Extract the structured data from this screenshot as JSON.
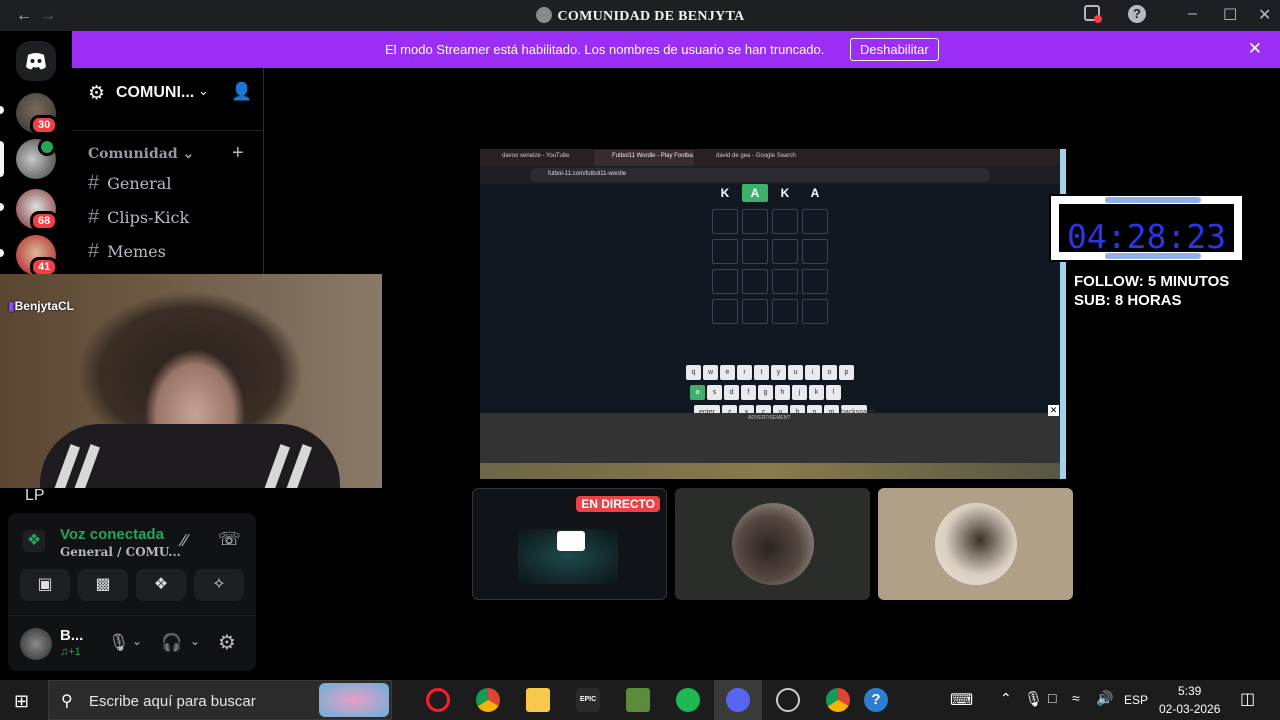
{
  "window": {
    "title": "COMUNIDAD DE BENJYTA",
    "back_icon": "arrow-left-icon",
    "forward_icon": "arrow-right-icon"
  },
  "banner": {
    "message": "El modo Streamer está habilitado. Los nombres de usuario se han truncado.",
    "button_label": "Deshabilitar"
  },
  "rail": {
    "badges": [
      "30",
      "68",
      "41"
    ]
  },
  "sidebar": {
    "server_name": "COMUNI...",
    "category": "Comunidad",
    "channels": [
      {
        "label": "General"
      },
      {
        "label": "Clips-Kick"
      },
      {
        "label": "Memes"
      }
    ]
  },
  "webcam": {
    "name": "BenjytaCL",
    "lp_label": "LP"
  },
  "voice": {
    "status": "Voz conectada",
    "channel": "General / COMU...",
    "user_name": "B...",
    "user_sub": "+1"
  },
  "stream": {
    "tabs": [
      "davoo xeneize - YouTube",
      "Futbol11 Wordle - Play Footba",
      "david de gea - Google Search"
    ],
    "url": "futbol-11.com/futbol11-wordle",
    "guess": [
      "K",
      "A",
      "K",
      "A"
    ],
    "keyboard_rows": [
      [
        "q",
        "w",
        "e",
        "r",
        "t",
        "y",
        "u",
        "i",
        "o",
        "p"
      ],
      [
        "a",
        "s",
        "d",
        "f",
        "g",
        "h",
        "j",
        "k",
        "l"
      ],
      [
        "enter",
        "z",
        "x",
        "c",
        "v",
        "b",
        "n",
        "m",
        "backspace"
      ]
    ],
    "ad_label": "ADVERTISEMENT",
    "live_badge": "EN DIRECTO"
  },
  "timer": {
    "time": "04:28:23",
    "line1": "FOLLOW: 5 MINUTOS",
    "line2": "SUB: 8 HORAS"
  },
  "taskbar": {
    "search_placeholder": "Escribe aquí para buscar",
    "language": "ESP",
    "time": "5:39",
    "date": "02-03-2026"
  },
  "colors": {
    "banner": "#9b2ef4",
    "voice_green": "#23a55a",
    "timer_blue": "#2a36e8",
    "live_red": "#ed4245"
  }
}
